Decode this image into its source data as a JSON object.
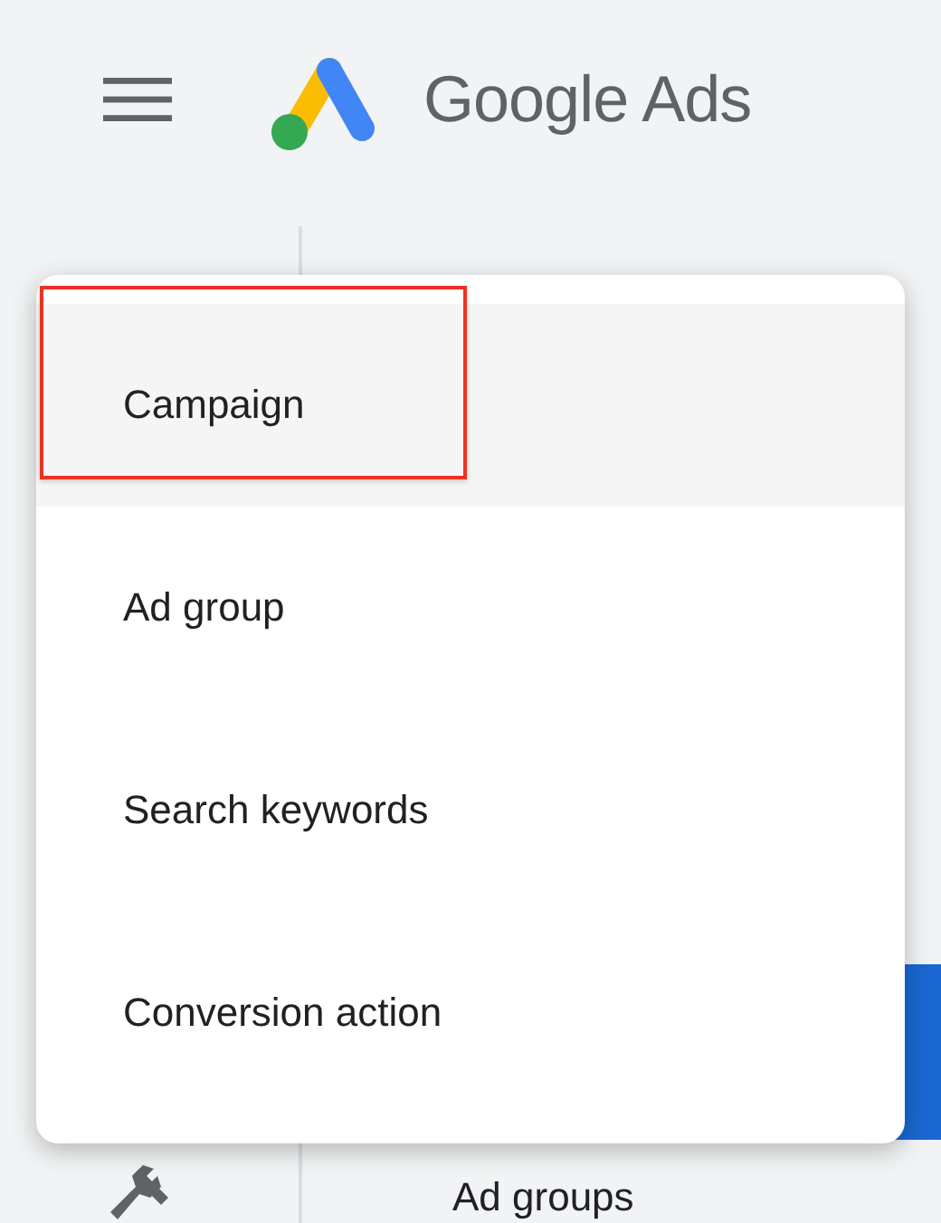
{
  "header": {
    "logo_text": "Google Ads"
  },
  "background": {
    "heading": "Ad groups"
  },
  "menu": {
    "items": [
      {
        "label": "Campaign",
        "selected": true,
        "highlighted": true
      },
      {
        "label": "Ad group",
        "selected": false,
        "highlighted": false
      },
      {
        "label": "Search keywords",
        "selected": false,
        "highlighted": false
      },
      {
        "label": "Conversion action",
        "selected": false,
        "highlighted": false
      }
    ]
  }
}
